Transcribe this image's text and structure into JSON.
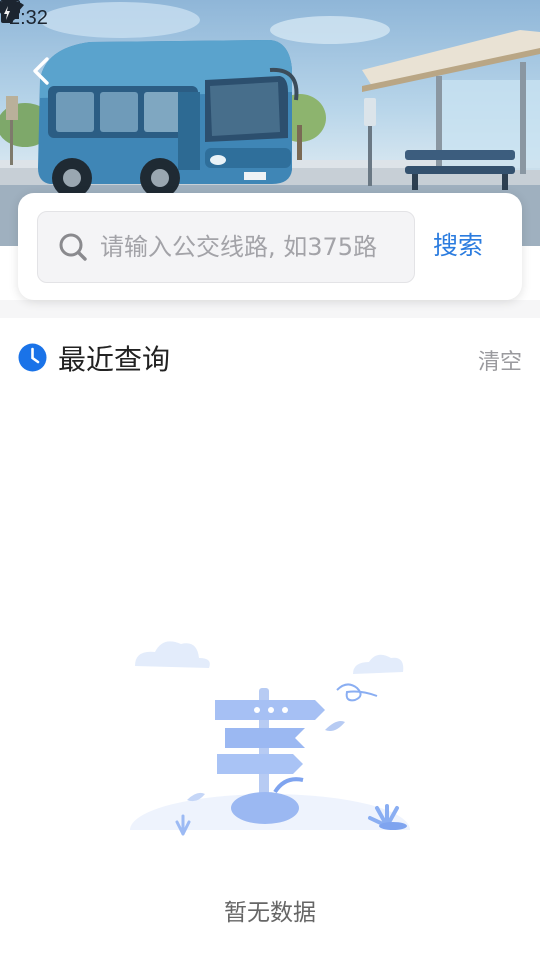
{
  "status_bar": {
    "time": "2:32",
    "left_icons": [
      "download-icon",
      "a-icon",
      "keyboard-icon"
    ],
    "right_icons": [
      "wifi-icon",
      "signal-icon",
      "battery-icon"
    ]
  },
  "header": {
    "back_icon": "chevron-left-icon",
    "banner_image": "bus-station-illustration"
  },
  "search": {
    "placeholder": "请输入公交线路, 如375路",
    "value": "",
    "button_label": "搜索",
    "icon": "search-icon"
  },
  "recent": {
    "icon": "clock-icon",
    "title": "最近查询",
    "clear_label": "清空",
    "items": []
  },
  "empty_state": {
    "illustration": "signpost-illustration",
    "text": "暂无数据"
  },
  "colors": {
    "accent": "#2b7cdf",
    "clock_blue": "#1a73e8",
    "muted_text": "#9a9a9e",
    "placeholder": "#a3a3a8"
  }
}
